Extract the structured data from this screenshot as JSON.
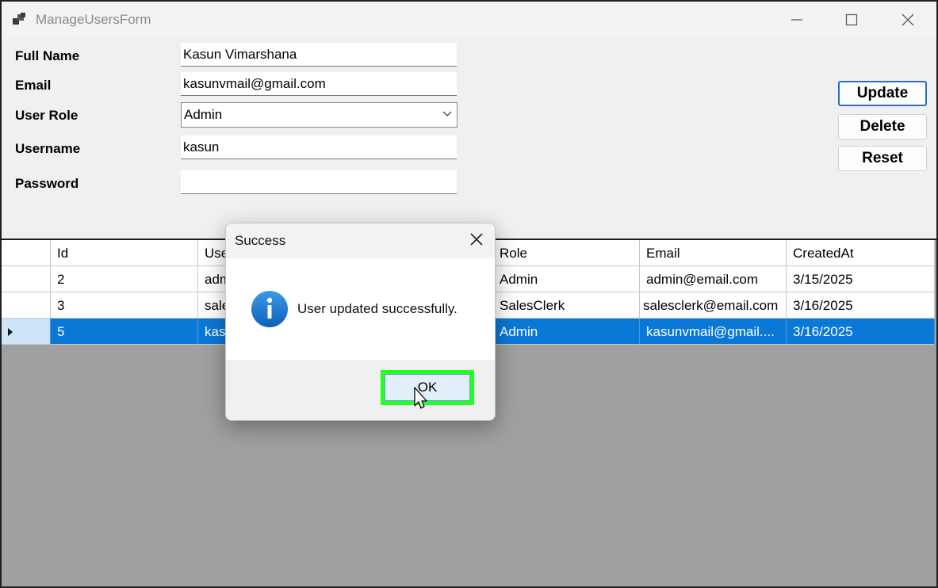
{
  "window": {
    "title": "ManageUsersForm"
  },
  "form": {
    "fullname_label": "Full Name",
    "fullname_value": "Kasun Vimarshana",
    "email_label": "Email",
    "email_value": "kasunvmail@gmail.com",
    "role_label": "User Role",
    "role_value": "Admin",
    "username_label": "Username",
    "username_value": "kasun",
    "password_label": "Password",
    "password_value": ""
  },
  "buttons": {
    "update": "Update",
    "delete": "Delete",
    "reset": "Reset"
  },
  "grid": {
    "headers": [
      "Id",
      "Use",
      "Role",
      "Email",
      "CreatedAt"
    ],
    "rows": [
      {
        "id": "2",
        "user": "adm",
        "role": "Admin",
        "email": "admin@email.com",
        "created": "3/15/2025"
      },
      {
        "id": "3",
        "user": "sale",
        "role": "SalesClerk",
        "email": "salesclerk@email.com",
        "created": "3/16/2025"
      },
      {
        "id": "5",
        "user": "kas",
        "role": "Admin",
        "email": "kasunvmail@gmail....",
        "created": "3/16/2025"
      }
    ]
  },
  "dialog": {
    "title": "Success",
    "message": "User updated successfully.",
    "ok": "OK"
  },
  "colors": {
    "selection": "#0a78d7",
    "highlight": "#22ff22",
    "info": "#1a73c8"
  }
}
